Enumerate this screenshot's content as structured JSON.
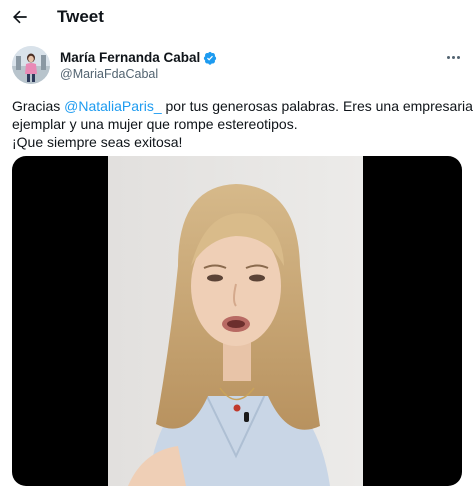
{
  "header": {
    "back_icon": "arrow-left-icon",
    "title": "Tweet"
  },
  "author": {
    "name": "María Fernanda Cabal",
    "handle": "@MariaFdaCabal",
    "verified_icon": "verified-badge-icon",
    "verified_color": "#1d9bf0"
  },
  "menu": {
    "icon": "more-horizontal-icon"
  },
  "tweet": {
    "text_before_mention": "Gracias ",
    "mention": "@NataliaParis_",
    "text_after_mention": " por tus generosas palabras. Eres una empresaria",
    "line2": "ejemplar y una mujer que rompe estereotipos.",
    "line3": "¡Que siempre seas exitosa!"
  },
  "media": {
    "type": "video",
    "subject": "woman-with-blonde-hair-speaking-into-lavalier-microphone"
  },
  "colors": {
    "accent": "#1d9bf0",
    "text": "#0f1419",
    "secondary_text": "#536471",
    "media_background": "#000000"
  }
}
